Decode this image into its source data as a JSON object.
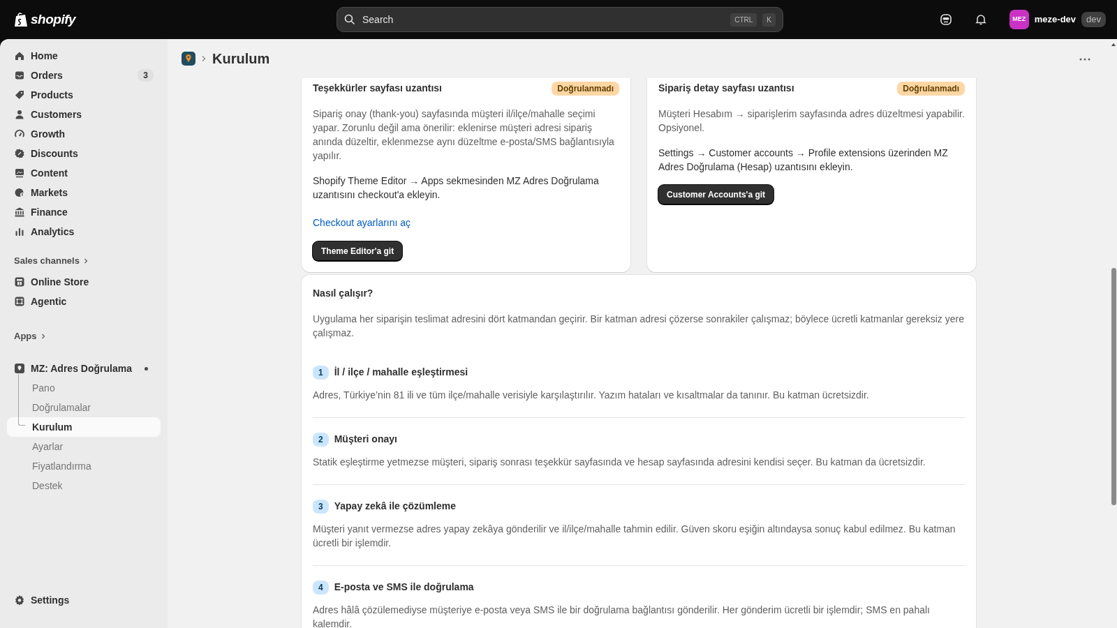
{
  "topbar": {
    "logo": "shopify",
    "search": {
      "placeholder": "Search",
      "keys": [
        "CTRL",
        "K"
      ]
    },
    "avatar": "MEZ",
    "store": "meze-dev",
    "store_badge": "dev"
  },
  "sidebar": {
    "items": [
      {
        "label": "Home",
        "selected": false
      },
      {
        "label": "Orders",
        "selected": false,
        "count": "3"
      },
      {
        "label": "Products",
        "selected": false
      },
      {
        "label": "Customers",
        "selected": false
      },
      {
        "label": "Growth",
        "selected": false
      },
      {
        "label": "Discounts",
        "selected": false
      },
      {
        "label": "Content",
        "selected": false
      },
      {
        "label": "Markets",
        "selected": false
      },
      {
        "label": "Finance",
        "selected": false
      },
      {
        "label": "Analytics",
        "selected": false
      }
    ],
    "sales_channels": {
      "heading": "Sales channels",
      "items": [
        {
          "label": "Online Store",
          "selected": false
        },
        {
          "label": "Agentic",
          "selected": false
        }
      ]
    },
    "apps": {
      "heading": "Apps",
      "app": {
        "label": "MZ: Adres Doğrulama",
        "children": [
          {
            "label": "Pano",
            "selected": false
          },
          {
            "label": "Doğrulamalar",
            "selected": false
          },
          {
            "label": "Kurulum",
            "selected": true
          },
          {
            "label": "Ayarlar",
            "selected": false
          },
          {
            "label": "Fiyatlandırma",
            "selected": false
          },
          {
            "label": "Destek",
            "selected": false
          }
        ]
      }
    },
    "settings": "Settings"
  },
  "page": {
    "title": "Kurulum"
  },
  "extension_cards": [
    {
      "title": "Teşekkürler sayfası uzantısı",
      "status": "Doğrulanmadı",
      "paragraphs": [
        {
          "kind": "muted",
          "text": "Sipariş onay (thank-you) sayfasında müşteri il/ilçe/mahalle seçimi yapar. Zorunlu değil ama önerilir: eklenirse müşteri adresi sipariş anında düzeltir, eklenmezse aynı düzeltme e-posta/SMS bağlantısıyla yapılır."
        },
        {
          "kind": "body",
          "text": "Shopify Theme Editor → Apps sekmesinden MZ Adres Doğrulama uzantısını checkout'a ekleyin."
        }
      ],
      "link": "Checkout ayarlarını aç",
      "button": "Theme Editor'a git"
    },
    {
      "title": "Sipariş detay sayfası uzantısı",
      "status": "Doğrulanmadı",
      "paragraphs": [
        {
          "kind": "muted",
          "text": "Müşteri Hesabım → siparişlerim sayfasında adres düzeltmesi yapabilir. Opsiyonel."
        },
        {
          "kind": "body",
          "text": "Settings → Customer accounts → Profile extensions üzerinden MZ Adres Doğrulama (Hesap) uzantısını ekleyin."
        }
      ],
      "button": "Customer Accounts'a git"
    }
  ],
  "how_it_works": {
    "title": "Nasıl çalışır?",
    "intro": "Uygulama her siparişin teslimat adresini dört katmandan geçirir. Bir katman adresi çözerse sonrakiler çalışmaz; böylece ücretli katmanlar gereksiz yere çalışmaz.",
    "steps": [
      {
        "number": "1",
        "title": "İl / ilçe / mahalle eşleştirmesi",
        "text": "Adres, Türkiye’nin 81 ili ve tüm ilçe/mahalle verisiyle karşılaştırılır. Yazım hataları ve kısaltmalar da tanınır. Bu katman ücretsizdir."
      },
      {
        "number": "2",
        "title": "Müşteri onayı",
        "text": "Statik eşleştirme yetmezse müşteri, sipariş sonrası teşekkür sayfasında ve hesap sayfasında adresini kendisi seçer. Bu katman da ücretsizdir."
      },
      {
        "number": "3",
        "title": "Yapay zekâ ile çözümleme",
        "text": "Müşteri yanıt vermezse adres yapay zekâya gönderilir ve il/ilçe/mahalle tahmin edilir. Güven skoru eşiğin altındaysa sonuç kabul edilmez. Bu katman ücretli bir işlemdir."
      },
      {
        "number": "4",
        "title": "E-posta ve SMS ile doğrulama",
        "text": "Adres hâlâ çözülemediyse müşteriye e-posta veya SMS ile bir doğrulama bağlantısı gönderilir. Her gönderim ücretli bir işlemdir; SMS en pahalı kalemdir."
      }
    ]
  }
}
